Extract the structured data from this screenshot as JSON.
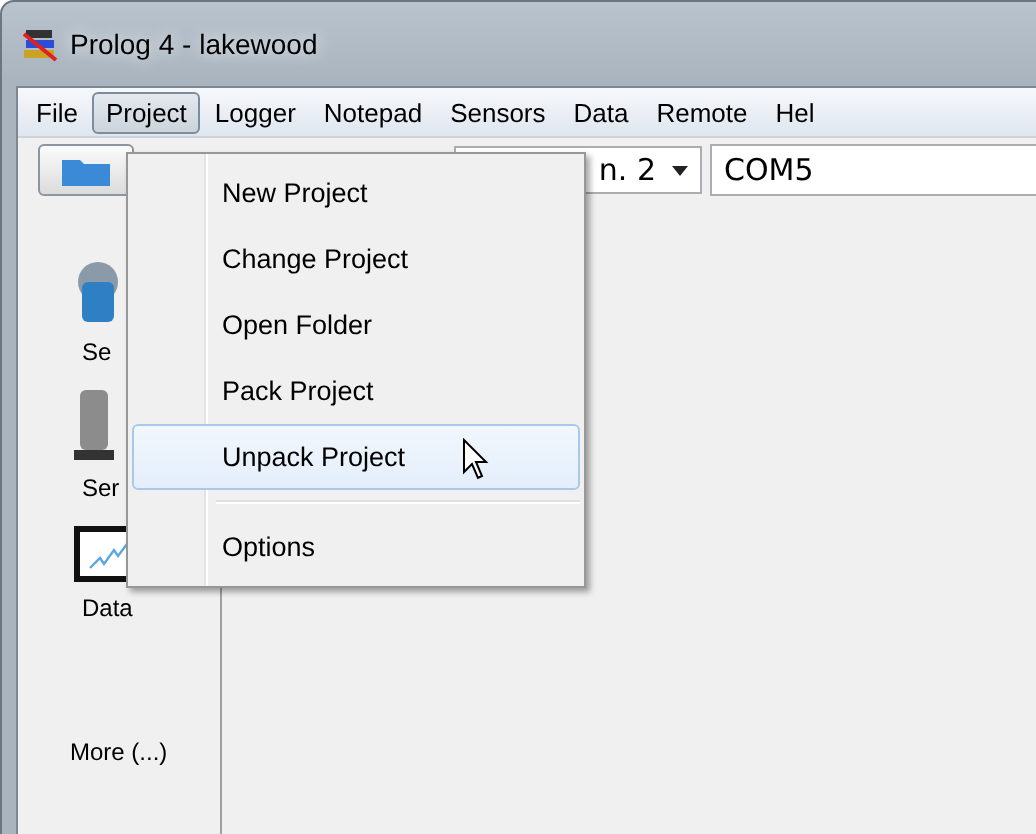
{
  "window": {
    "title": "Prolog 4 - lakewood"
  },
  "menu_bar": [
    {
      "label": "File",
      "selected": false
    },
    {
      "label": "Project",
      "selected": true
    },
    {
      "label": "Logger",
      "selected": false
    },
    {
      "label": "Notepad",
      "selected": false
    },
    {
      "label": "Sensors",
      "selected": false
    },
    {
      "label": "Data",
      "selected": false
    },
    {
      "label": "Remote",
      "selected": false
    },
    {
      "label": "Hel",
      "selected": false
    }
  ],
  "toolbar": {
    "combo": {
      "value": "n. 2"
    },
    "port_field": {
      "value": "COM5"
    }
  },
  "sidebar": {
    "items": [
      {
        "label": "Se",
        "kind": "setup"
      },
      {
        "label": "Ser",
        "kind": "sensor"
      },
      {
        "label": "Data",
        "kind": "data"
      }
    ],
    "more": "More (...)"
  },
  "project_menu": [
    {
      "label": "New Project",
      "selected": false,
      "kind": "item"
    },
    {
      "label": "Change Project",
      "selected": false,
      "kind": "item"
    },
    {
      "label": "Open Folder",
      "selected": false,
      "kind": "item"
    },
    {
      "label": "Pack Project",
      "selected": false,
      "kind": "item"
    },
    {
      "label": "Unpack Project",
      "selected": true,
      "kind": "item"
    },
    {
      "kind": "separator"
    },
    {
      "label": "Options",
      "selected": false,
      "kind": "item"
    }
  ]
}
